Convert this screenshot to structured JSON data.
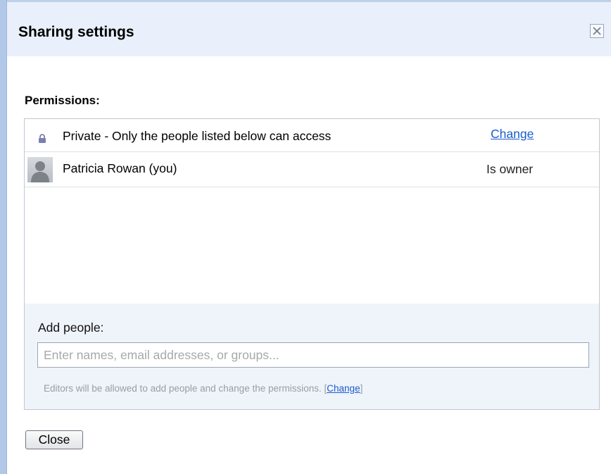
{
  "dialog": {
    "title": "Sharing settings",
    "close_icon": "close-x-icon"
  },
  "permissions": {
    "section_label": "Permissions:",
    "visibility": {
      "icon": "lock-icon",
      "text": "Private - Only the people listed below can access",
      "change_label": "Change"
    },
    "people": [
      {
        "icon": "avatar-icon",
        "name": "Patricia Rowan (you)",
        "role": "Is owner"
      }
    ]
  },
  "add_people": {
    "label": "Add people:",
    "input_value": "",
    "input_placeholder": "Enter names, email addresses, or groups...",
    "note_text": "Editors will be allowed to add people and change the permissions.",
    "note_bracket_open": "[",
    "note_link_label": "Change",
    "note_bracket_close": "]"
  },
  "footer": {
    "close_label": "Close"
  },
  "colors": {
    "link": "#1a5ccf",
    "header_bg": "#e9f0fb",
    "add_area_bg": "#eff3fa",
    "left_bar": "#b2c8e8"
  }
}
